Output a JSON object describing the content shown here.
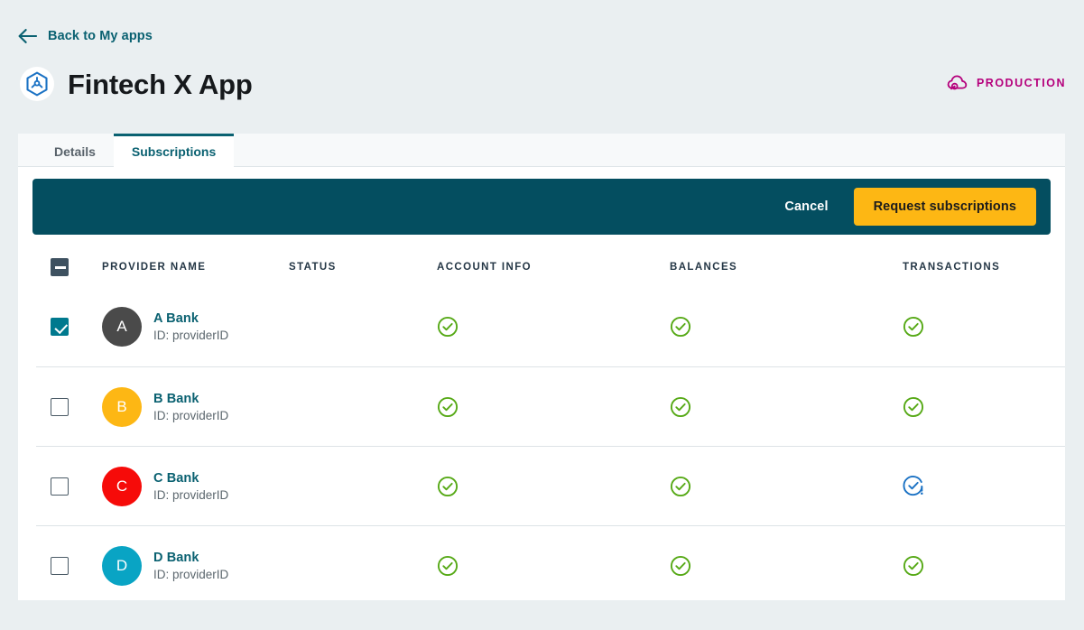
{
  "back": {
    "label": "Back to My apps",
    "icon": "arrow-left-icon"
  },
  "header": {
    "app_icon": "hexagon-app-icon",
    "title": "Fintech X App",
    "environment": {
      "label": "PRODUCTION",
      "icon": "cloud-upload-icon",
      "color": "#b5007c"
    }
  },
  "tabs": [
    {
      "label": "Details",
      "active": false
    },
    {
      "label": "Subscriptions",
      "active": true
    }
  ],
  "action_bar": {
    "background": "#044e60",
    "cancel_label": "Cancel",
    "request_label": "Request subscriptions",
    "request_color": "#fdb714"
  },
  "table": {
    "select_all": {
      "state": "indeterminate",
      "name": "select-all-checkbox"
    },
    "columns": [
      {
        "key": "provider_name",
        "label": "PROVIDER NAME"
      },
      {
        "key": "status",
        "label": "STATUS"
      },
      {
        "key": "account_info",
        "label": "ACCOUNT INFO"
      },
      {
        "key": "balances",
        "label": "BALANCES"
      },
      {
        "key": "transactions",
        "label": "TRANSACTIONS"
      }
    ],
    "rows": [
      {
        "selected": true,
        "avatar_letter": "A",
        "avatar_color": "#4a4a4a",
        "provider_name": "A Bank",
        "provider_id": "ID: providerID",
        "status": "",
        "account_info": "check-circle-green",
        "balances": "check-circle-green",
        "transactions": "check-circle-green"
      },
      {
        "selected": false,
        "avatar_letter": "B",
        "avatar_color": "#fdb714",
        "provider_name": "B Bank",
        "provider_id": "ID: providerID",
        "status": "",
        "account_info": "check-circle-green",
        "balances": "check-circle-green",
        "transactions": "check-circle-green"
      },
      {
        "selected": false,
        "avatar_letter": "C",
        "avatar_color": "#f60b09",
        "provider_name": "C Bank",
        "provider_id": "ID: providerID",
        "status": "",
        "account_info": "check-circle-green",
        "balances": "check-circle-green",
        "transactions": "check-circle-blue-alert"
      },
      {
        "selected": false,
        "avatar_letter": "D",
        "avatar_color": "#09a4c4",
        "provider_name": "D Bank",
        "provider_id": "ID: providerID",
        "status": "",
        "account_info": "check-circle-green",
        "balances": "check-circle-green",
        "transactions": "check-circle-green"
      }
    ]
  },
  "colors": {
    "page_background": "#eaeff1",
    "card_background": "#ffffff",
    "teal": "#0a6171",
    "green": "#56a916",
    "blue": "#1b72c4"
  }
}
